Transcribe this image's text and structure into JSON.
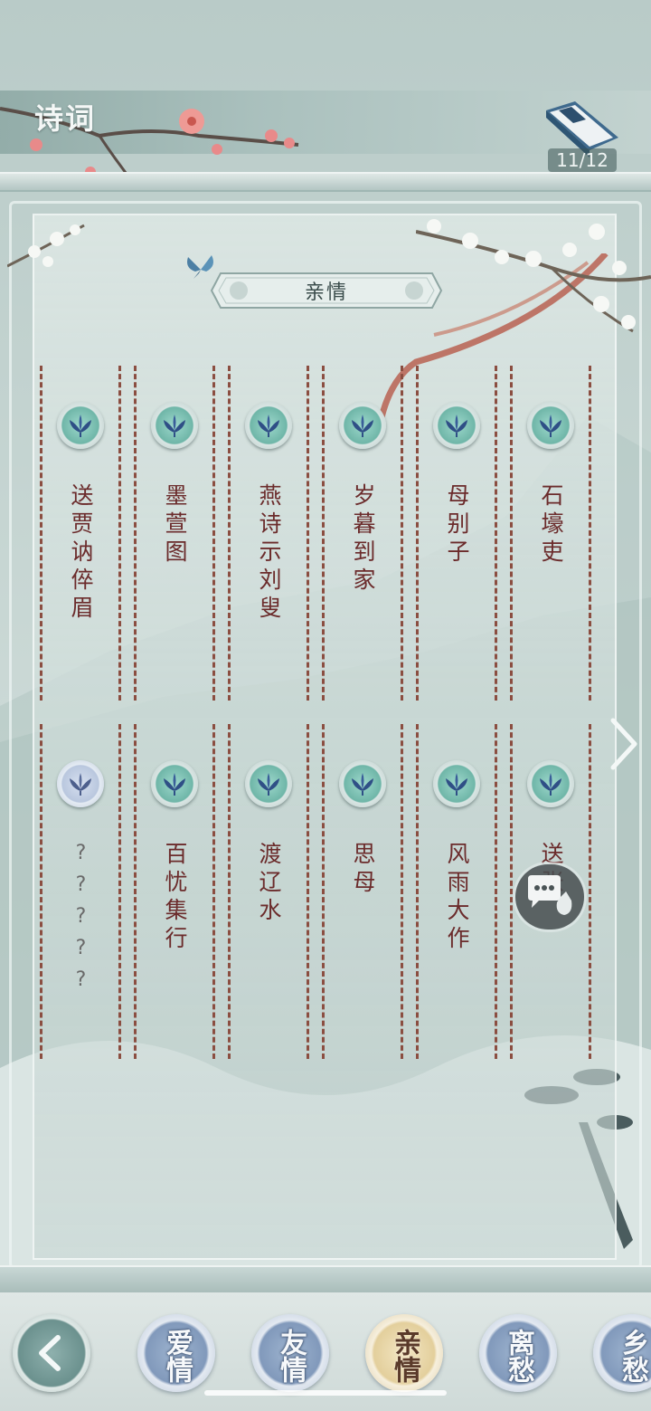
{
  "header": {
    "title": "诗词",
    "page_counter": "11/12",
    "book_icon": "poetry-book-icon"
  },
  "category": {
    "label": "亲情"
  },
  "poems": [
    {
      "title": "送贾讷倅眉",
      "locked": false
    },
    {
      "title": "墨萱图",
      "locked": false
    },
    {
      "title": "燕诗示刘叟",
      "locked": false
    },
    {
      "title": "岁暮到家",
      "locked": false
    },
    {
      "title": "母别子",
      "locked": false
    },
    {
      "title": "石壕吏",
      "locked": false
    },
    {
      "title": "?????",
      "locked": true
    },
    {
      "title": "百忧集行",
      "locked": false
    },
    {
      "title": "渡辽水",
      "locked": false
    },
    {
      "title": "思母",
      "locked": false
    },
    {
      "title": "风雨大作",
      "locked": false
    },
    {
      "title": "送张",
      "locked": false
    }
  ],
  "controls": {
    "next_icon": "chevron-right-icon",
    "chat_icon": "chat-bubble-icon",
    "back_icon": "back-arrow-icon"
  },
  "tabs": [
    {
      "label": "爱情",
      "active": false
    },
    {
      "label": "友情",
      "active": false
    },
    {
      "label": "亲情",
      "active": true
    },
    {
      "label": "离愁",
      "active": false
    },
    {
      "label": "乡愁",
      "active": false
    }
  ],
  "colors": {
    "poem_title": "#6b2b2b",
    "column_border": "#8b4e41",
    "active_tab": "#e3cf9c",
    "inactive_tab": "#8199bb"
  }
}
